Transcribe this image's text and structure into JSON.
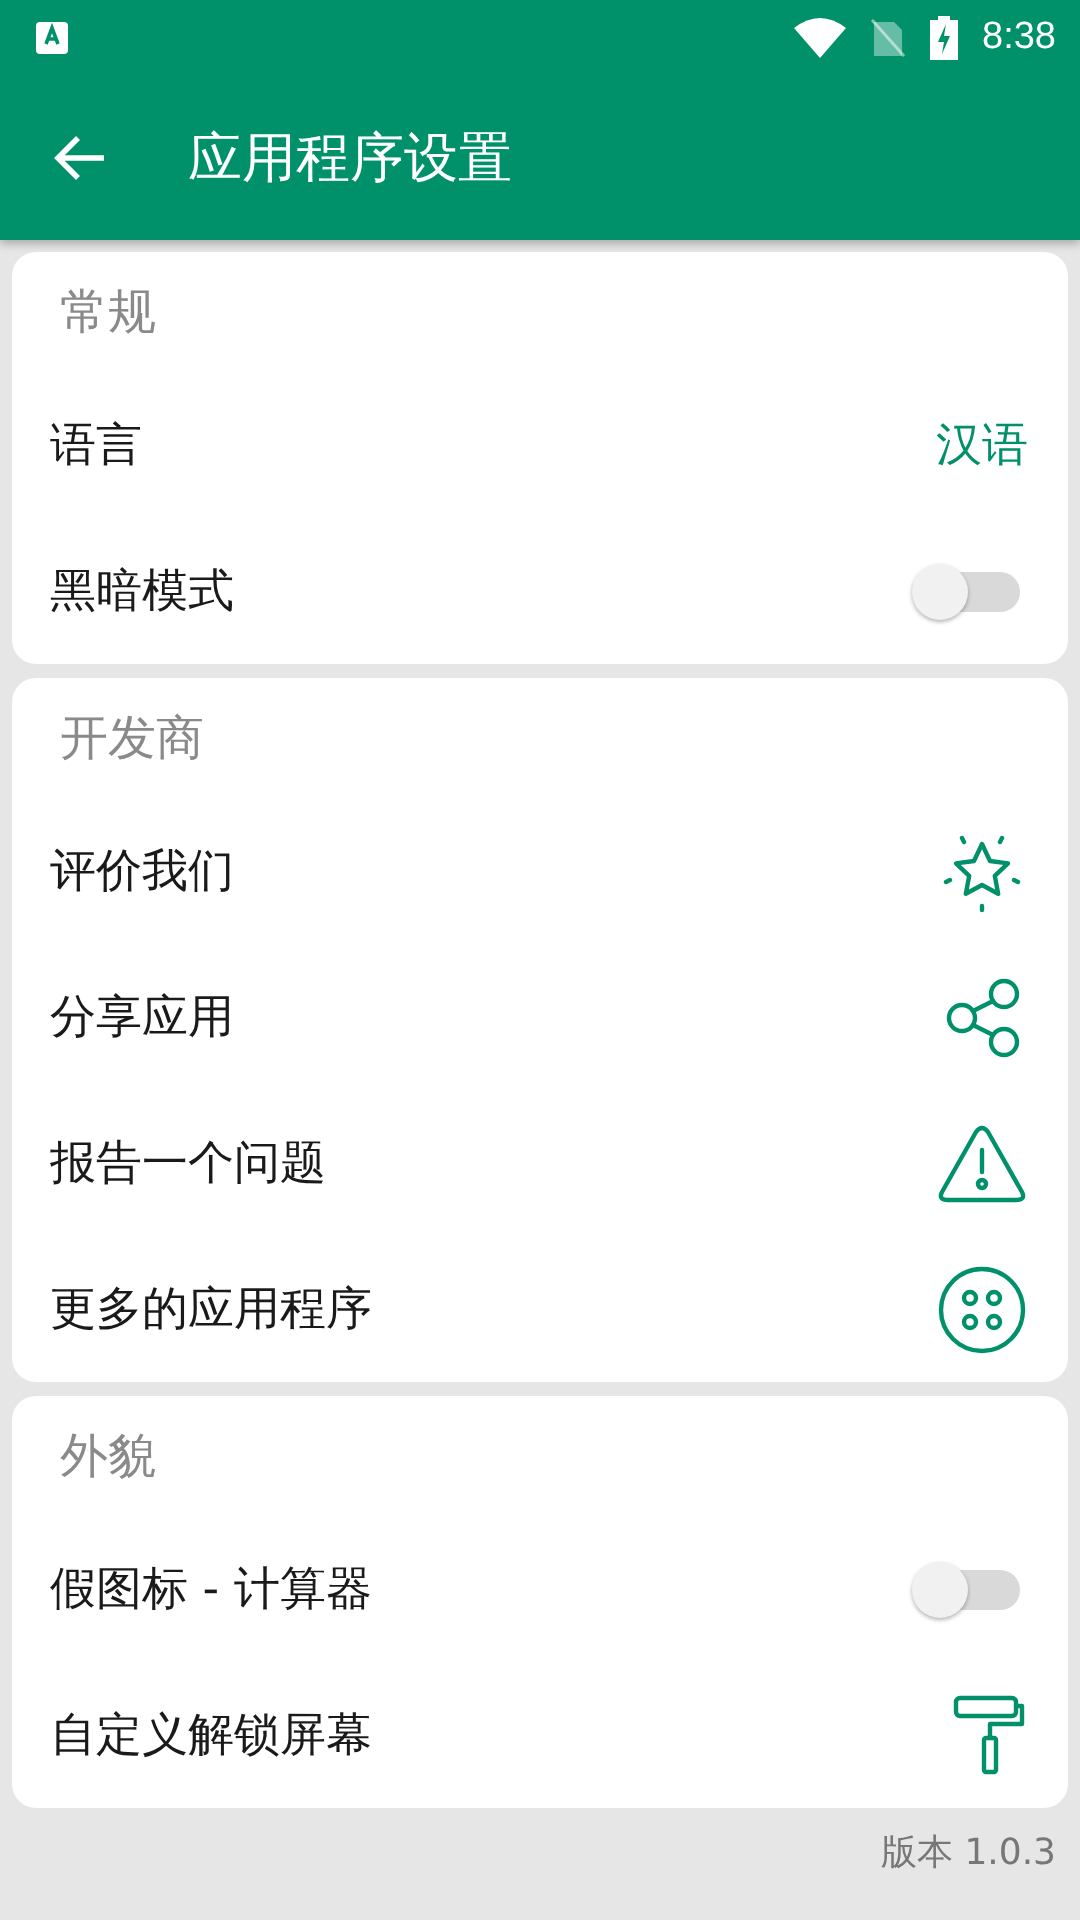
{
  "status_bar": {
    "time": "8:38"
  },
  "app_bar": {
    "title": "应用程序设置"
  },
  "sections": [
    {
      "title": "常规",
      "rows": [
        {
          "kind": "value",
          "label": "语言",
          "value": "汉语"
        },
        {
          "kind": "toggle",
          "label": "黑暗模式",
          "on": false
        }
      ]
    },
    {
      "title": "开发商",
      "rows": [
        {
          "kind": "link",
          "label": "评价我们"
        },
        {
          "kind": "link",
          "label": "分享应用"
        },
        {
          "kind": "link",
          "label": "报告一个问题"
        },
        {
          "kind": "link",
          "label": "更多的应用程序"
        }
      ]
    },
    {
      "title": "外貌",
      "rows": [
        {
          "kind": "toggle",
          "label": "假图标 - 计算器",
          "on": false
        },
        {
          "kind": "link",
          "label": "自定义解锁屏幕"
        }
      ]
    }
  ],
  "version": "版本 1.0.3"
}
